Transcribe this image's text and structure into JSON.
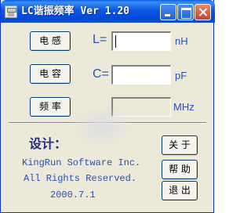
{
  "window": {
    "title": "LC谐振频率 Ver 1.20"
  },
  "buttons": {
    "inductance": "电 感",
    "capacitance": "电 容",
    "frequency": "频 率",
    "about": "关 于",
    "help": "帮 助",
    "exit": "退 出"
  },
  "fields": {
    "L": {
      "label": "L=",
      "value": "",
      "unit": "nH"
    },
    "C": {
      "label": "C=",
      "value": "",
      "unit": "pF"
    },
    "F": {
      "label": "",
      "value": "",
      "unit": "MHz"
    }
  },
  "credits": {
    "design_label": "设计：",
    "company": "KingRun Software Inc.",
    "rights": "All Rights Reserved.",
    "date": "2000.7.1"
  },
  "colors": {
    "title_bar": "#0a58e0",
    "label_text": "#2b4fb8",
    "window_bg": "#ece9d8"
  }
}
